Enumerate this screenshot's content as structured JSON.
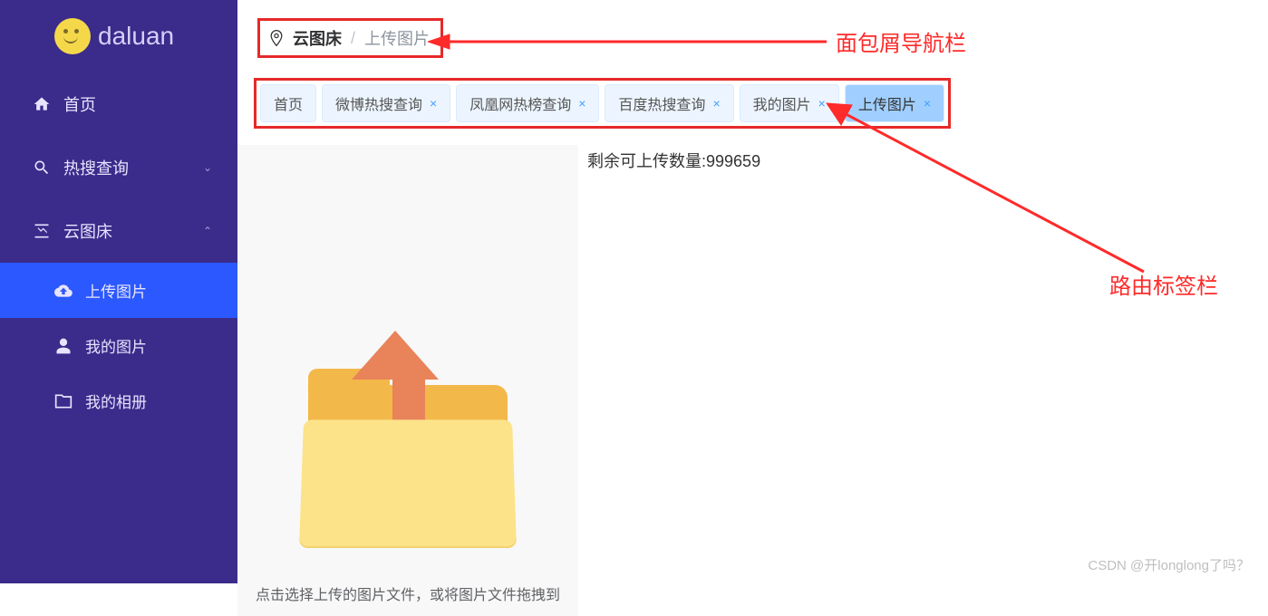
{
  "brand": "daluan",
  "sidebar": {
    "items": [
      {
        "icon": "home",
        "label": "首页"
      },
      {
        "icon": "search",
        "label": "热搜查询",
        "chev": "down"
      },
      {
        "icon": "chart",
        "label": "云图床",
        "chev": "up"
      }
    ],
    "submenu": [
      {
        "icon": "cloud-upload",
        "label": "上传图片",
        "active": true
      },
      {
        "icon": "person",
        "label": "我的图片"
      },
      {
        "icon": "folder",
        "label": "我的相册"
      }
    ]
  },
  "breadcrumb": {
    "first": "云图床",
    "sep": "/",
    "last": "上传图片"
  },
  "tabs": [
    {
      "label": "首页",
      "closable": false
    },
    {
      "label": "微博热搜查询",
      "closable": true
    },
    {
      "label": "凤凰网热榜查询",
      "closable": true
    },
    {
      "label": "百度热搜查询",
      "closable": true
    },
    {
      "label": "我的图片",
      "closable": true
    },
    {
      "label": "上传图片",
      "closable": true,
      "active": true
    }
  ],
  "quota": {
    "prefix": "剩余可上传数量:",
    "value": "999659"
  },
  "upload_hint": "点击选择上传的图片文件，或将图片文件拖拽到",
  "annotations": {
    "breadcrumb_label": "面包屑导航栏",
    "tabs_label": "路由标签栏"
  },
  "watermark": "CSDN @开longlong了吗？"
}
